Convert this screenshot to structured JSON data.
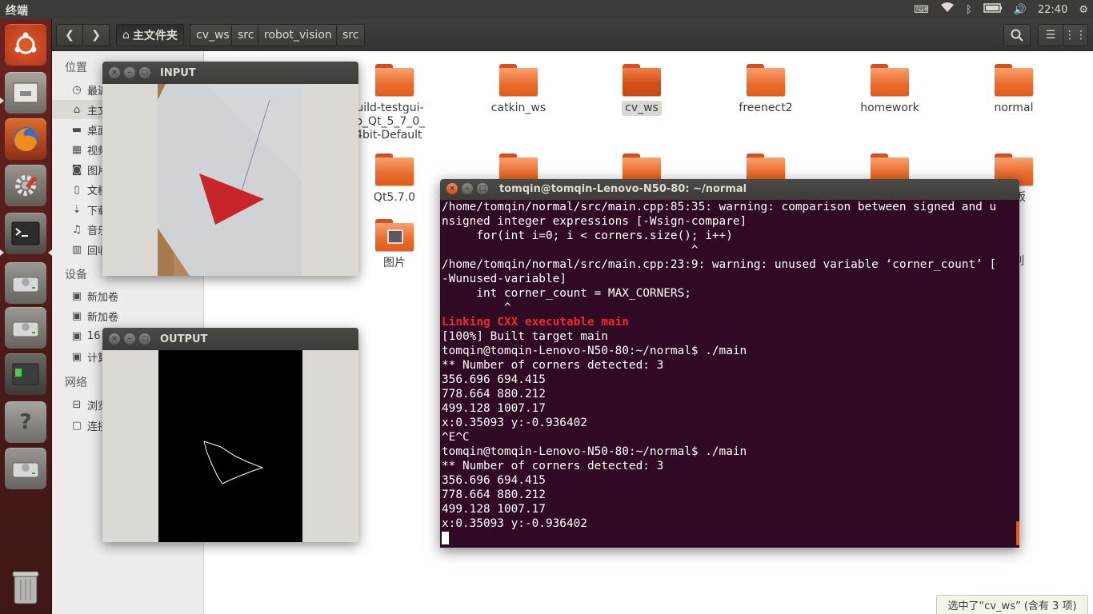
{
  "topbar": {
    "app_title": "终端",
    "clock": "22:40"
  },
  "launcher": {
    "items": [
      "ubuntu-dash",
      "files",
      "firefox",
      "system-settings",
      "terminal",
      "disk-1",
      "disk-2",
      "qt-creator",
      "help",
      "disk-3",
      "trash"
    ]
  },
  "file_manager": {
    "breadcrumbs": [
      "主文件夹",
      "cv_ws",
      "src",
      "robot_vision",
      "src"
    ],
    "sidebar": {
      "places_header": "位置",
      "places": [
        "最近",
        "主文件夹",
        "桌面",
        "视频",
        "图片",
        "文档",
        "下载",
        "音乐",
        "回收站"
      ],
      "devices_header": "设备",
      "devices": [
        "新加卷",
        "新加卷",
        "16",
        "计算机"
      ],
      "network_header": "网络",
      "network": [
        "浏览网络",
        "连接到服务器"
      ]
    },
    "folders": {
      "build": [
        "build-testgui-",
        "sktop_Qt_5_7_0_",
        "C_64bit-Default"
      ],
      "catkin_ws": "catkin_ws",
      "cv_ws": "cv_ws",
      "freenect2": "freenect2",
      "homework": "homework",
      "normal": "normal",
      "qt": "Qt5.7.0",
      "pictures": "图片",
      "templates_partial": "板",
      "examples_partial": "列"
    },
    "status_tip": "选中了“cv_ws” (含有 3 项)"
  },
  "input_window": {
    "title": "INPUT"
  },
  "output_window": {
    "title": "OUTPUT"
  },
  "terminal": {
    "title": "tomqin@tomqin-Lenovo-N50-80: ~/normal",
    "lines": [
      {
        "t": "/home/tomqin/normal/src/main.cpp:85:35: warning: comparison between signed and u",
        "c": ""
      },
      {
        "t": "nsigned integer expressions [-Wsign-compare]",
        "c": ""
      },
      {
        "t": "     for(int i=0; i < corners.size(); i++)",
        "c": ""
      },
      {
        "t": "                                    ^",
        "c": ""
      },
      {
        "t": "/home/tomqin/normal/src/main.cpp:23:9: warning: unused variable ‘corner_count’ [",
        "c": ""
      },
      {
        "t": "-Wunused-variable]",
        "c": ""
      },
      {
        "t": "     int corner_count = MAX_CORNERS;",
        "c": ""
      },
      {
        "t": "         ^",
        "c": ""
      },
      {
        "t": "Linking CXX executable main",
        "c": "red"
      },
      {
        "t": "[100%] Built target main",
        "c": ""
      },
      {
        "t": "tomqin@tomqin-Lenovo-N50-80:~/normal$ ./main",
        "c": ""
      },
      {
        "t": "** Number of corners detected: 3",
        "c": ""
      },
      {
        "t": "356.696 694.415",
        "c": ""
      },
      {
        "t": "778.664 880.212",
        "c": ""
      },
      {
        "t": "499.128 1007.17",
        "c": ""
      },
      {
        "t": "x:0.35093 y:-0.936402",
        "c": ""
      },
      {
        "t": "^E^C",
        "c": ""
      },
      {
        "t": "tomqin@tomqin-Lenovo-N50-80:~/normal$ ./main",
        "c": ""
      },
      {
        "t": "** Number of corners detected: 3",
        "c": ""
      },
      {
        "t": "356.696 694.415",
        "c": ""
      },
      {
        "t": "778.664 880.212",
        "c": ""
      },
      {
        "t": "499.128 1007.17",
        "c": ""
      },
      {
        "t": "x:0.35093 y:-0.936402",
        "c": ""
      }
    ]
  },
  "colors": {
    "terminal_bg": "#300a24",
    "accent": "#e95420",
    "error_red": "#ef2929",
    "folder_orange": "#ea6e2f"
  }
}
